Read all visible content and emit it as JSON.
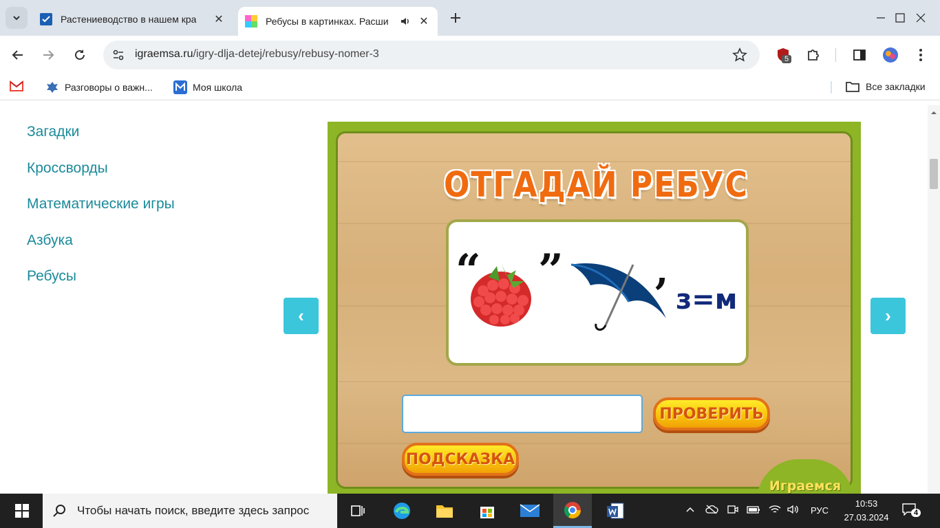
{
  "tabs": [
    {
      "title": "Растениеводство в нашем кра",
      "close": "✕"
    },
    {
      "title": "Ребусы в картинках. Расши",
      "close": "✕"
    }
  ],
  "address": {
    "domain": "igraemsa.ru",
    "path": "/igry-dlja-detej/rebusy/rebusy-nomer-3"
  },
  "extensions": {
    "badge_count": "5"
  },
  "bookmarks": [
    {
      "label": "Разговоры о важн..."
    },
    {
      "label": "Моя школа"
    }
  ],
  "bookmarks_all": "Все закладки",
  "menu": {
    "items": [
      "Загадки",
      "Кроссворды",
      "Математические игры",
      "Азбука",
      "Ребусы"
    ]
  },
  "game": {
    "title": "ОТГАДАЙ РЕБУС",
    "rebus_equation": "з=м",
    "check_button": "ПРОВЕРИТЬ",
    "hint_button": "ПОДСКАЗКА",
    "logo": "Играемся",
    "prev_arrow": "‹",
    "next_arrow": "›",
    "answer_value": ""
  },
  "taskbar": {
    "search_placeholder": "Чтобы начать поиск, введите здесь запрос",
    "language": "РУС",
    "time": "10:53",
    "date": "27.03.2024",
    "notifications": "4"
  },
  "colors": {
    "link": "#1b8a9a",
    "arrow_button": "#3cc6dc",
    "title_orange": "#f06b10",
    "board_green": "#8db526"
  }
}
